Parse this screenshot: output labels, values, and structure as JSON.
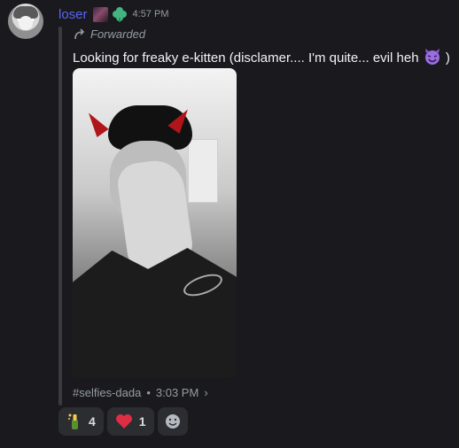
{
  "message": {
    "author": "loser",
    "timestamp": "4:57 PM",
    "forwarded_label": "Forwarded",
    "text": "Looking for freaky e-kitten (disclamer.... I'm quite... evil heh",
    "text_end": ")",
    "footer": {
      "channel": "#selfies-dada",
      "separator": "•",
      "time": "3:03 PM",
      "chevron": "›"
    }
  },
  "reactions": [
    {
      "icon": "champagne-bottle-icon",
      "count": "4"
    },
    {
      "icon": "red-heart-icon",
      "count": "1"
    },
    {
      "icon": "add-reaction-icon",
      "count": ""
    }
  ]
}
